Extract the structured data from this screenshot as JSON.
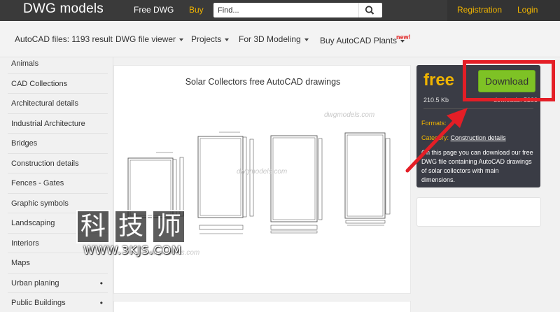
{
  "header": {
    "logo": "DWG models",
    "nav_free": "Free DWG",
    "nav_buy": "Buy",
    "search_placeholder": "Find...",
    "registration": "Registration",
    "login": "Login"
  },
  "filters": {
    "count": "AutoCAD files: 1193 result",
    "items": [
      "DWG file viewer",
      "Projects",
      "For 3D Modeling",
      "Buy AutoCAD Plants"
    ],
    "new_badge": "new!"
  },
  "sidebar": {
    "items": [
      {
        "label": "Animals",
        "dot": ""
      },
      {
        "label": "CAD Collections",
        "dot": ""
      },
      {
        "label": "Architectural details",
        "dot": ""
      },
      {
        "label": "Industrial Architecture",
        "dot": ""
      },
      {
        "label": "Bridges",
        "dot": ""
      },
      {
        "label": "Construction details",
        "dot": ""
      },
      {
        "label": "Fences - Gates",
        "dot": ""
      },
      {
        "label": "Graphic symbols",
        "dot": ""
      },
      {
        "label": "Landscaping",
        "dot": ""
      },
      {
        "label": "Interiors",
        "dot": ""
      },
      {
        "label": "Maps",
        "dot": ""
      },
      {
        "label": "Urban planing",
        "dot": "•"
      },
      {
        "label": "Public Buildings",
        "dot": "•"
      }
    ]
  },
  "main": {
    "title": "Solar Collectors free AutoCAD drawings",
    "watermark": "dwgmodels.com"
  },
  "overlay": {
    "chars": [
      "科",
      "技",
      "师"
    ],
    "url": "WWW.3KJS.COM"
  },
  "panel": {
    "free": "free",
    "download": "Download",
    "size": "210.5 Kb",
    "size_partial": "dowloads: 5283",
    "formats": "Formats:",
    "category_label": "Category:",
    "category": "Construction details",
    "description": "On this page you can download our free DWG file containing AutoCAD drawings of solar collectors with main dimensions."
  },
  "colors": {
    "accent": "#f0b400",
    "download_green": "#7ec225",
    "annotation_red": "#e41e26",
    "header_bg": "#3a3a3a"
  }
}
